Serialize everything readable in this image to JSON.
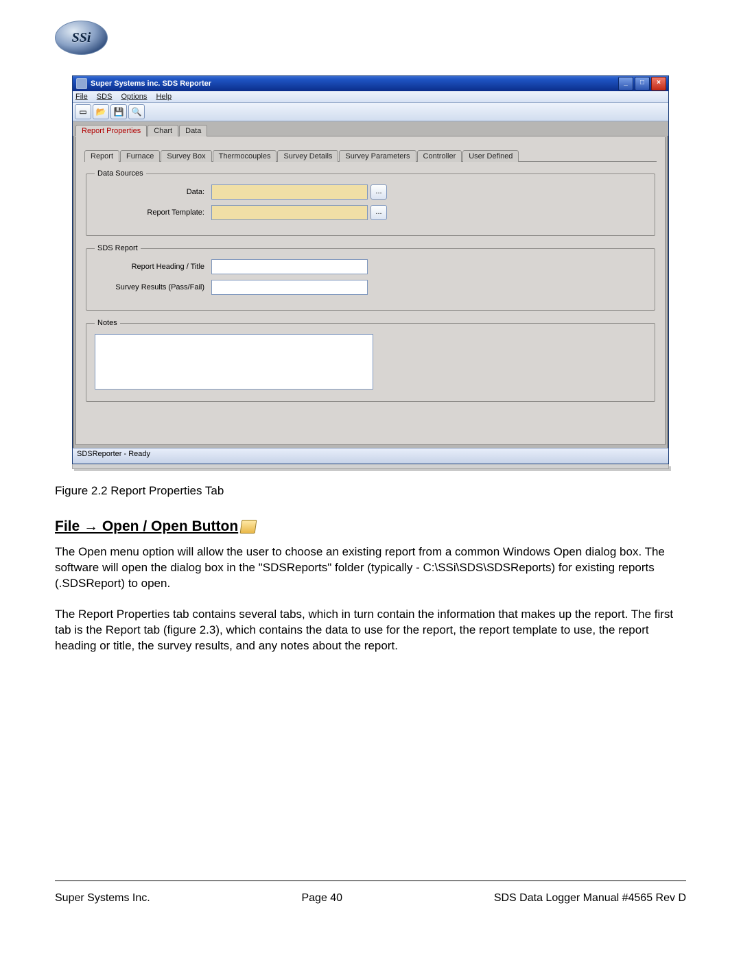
{
  "logo_text": "SSi",
  "window": {
    "title": "Super Systems inc. SDS Reporter",
    "controls": {
      "min": "_",
      "max": "□",
      "close": "×"
    },
    "menubar": [
      "File",
      "SDS",
      "Options",
      "Help"
    ],
    "toolbar_icons": [
      "new",
      "open",
      "save",
      "print-preview"
    ],
    "tabs": [
      "Report Properties",
      "Chart",
      "Data"
    ],
    "subtabs": [
      "Report",
      "Furnace",
      "Survey Box",
      "Thermocouples",
      "Survey Details",
      "Survey Parameters",
      "Controller",
      "User Defined"
    ],
    "groups": {
      "data_sources": {
        "legend": "Data Sources",
        "data_label": "Data:",
        "data_value": "",
        "template_label": "Report Template:",
        "template_value": ""
      },
      "sds_report": {
        "legend": "SDS Report",
        "heading_label": "Report Heading / Title",
        "heading_value": "",
        "results_label": "Survey Results (Pass/Fail)",
        "results_value": ""
      },
      "notes": {
        "legend": "Notes",
        "value": ""
      }
    },
    "browse": "...",
    "status": "SDSReporter - Ready"
  },
  "caption": "Figure 2.2 Report Properties Tab",
  "section_heading": "File → Open / Open Button",
  "paragraph1": "The Open menu option will allow the user to choose an existing report from a common Windows Open dialog box.  The software will open the dialog box in the \"SDSReports\" folder (typically - C:\\SSi\\SDS\\SDSReports) for existing reports (.SDSReport) to open.",
  "paragraph2": "The Report Properties tab contains several tabs, which in turn contain the information that makes up the report.  The first tab is the Report tab (figure 2.3), which contains the data to use for the report, the report template to use, the report heading or title, the survey results, and any notes about the report.",
  "footer": {
    "left": "Super Systems Inc.",
    "center": "Page 40",
    "right": "SDS Data Logger Manual #4565 Rev D"
  }
}
